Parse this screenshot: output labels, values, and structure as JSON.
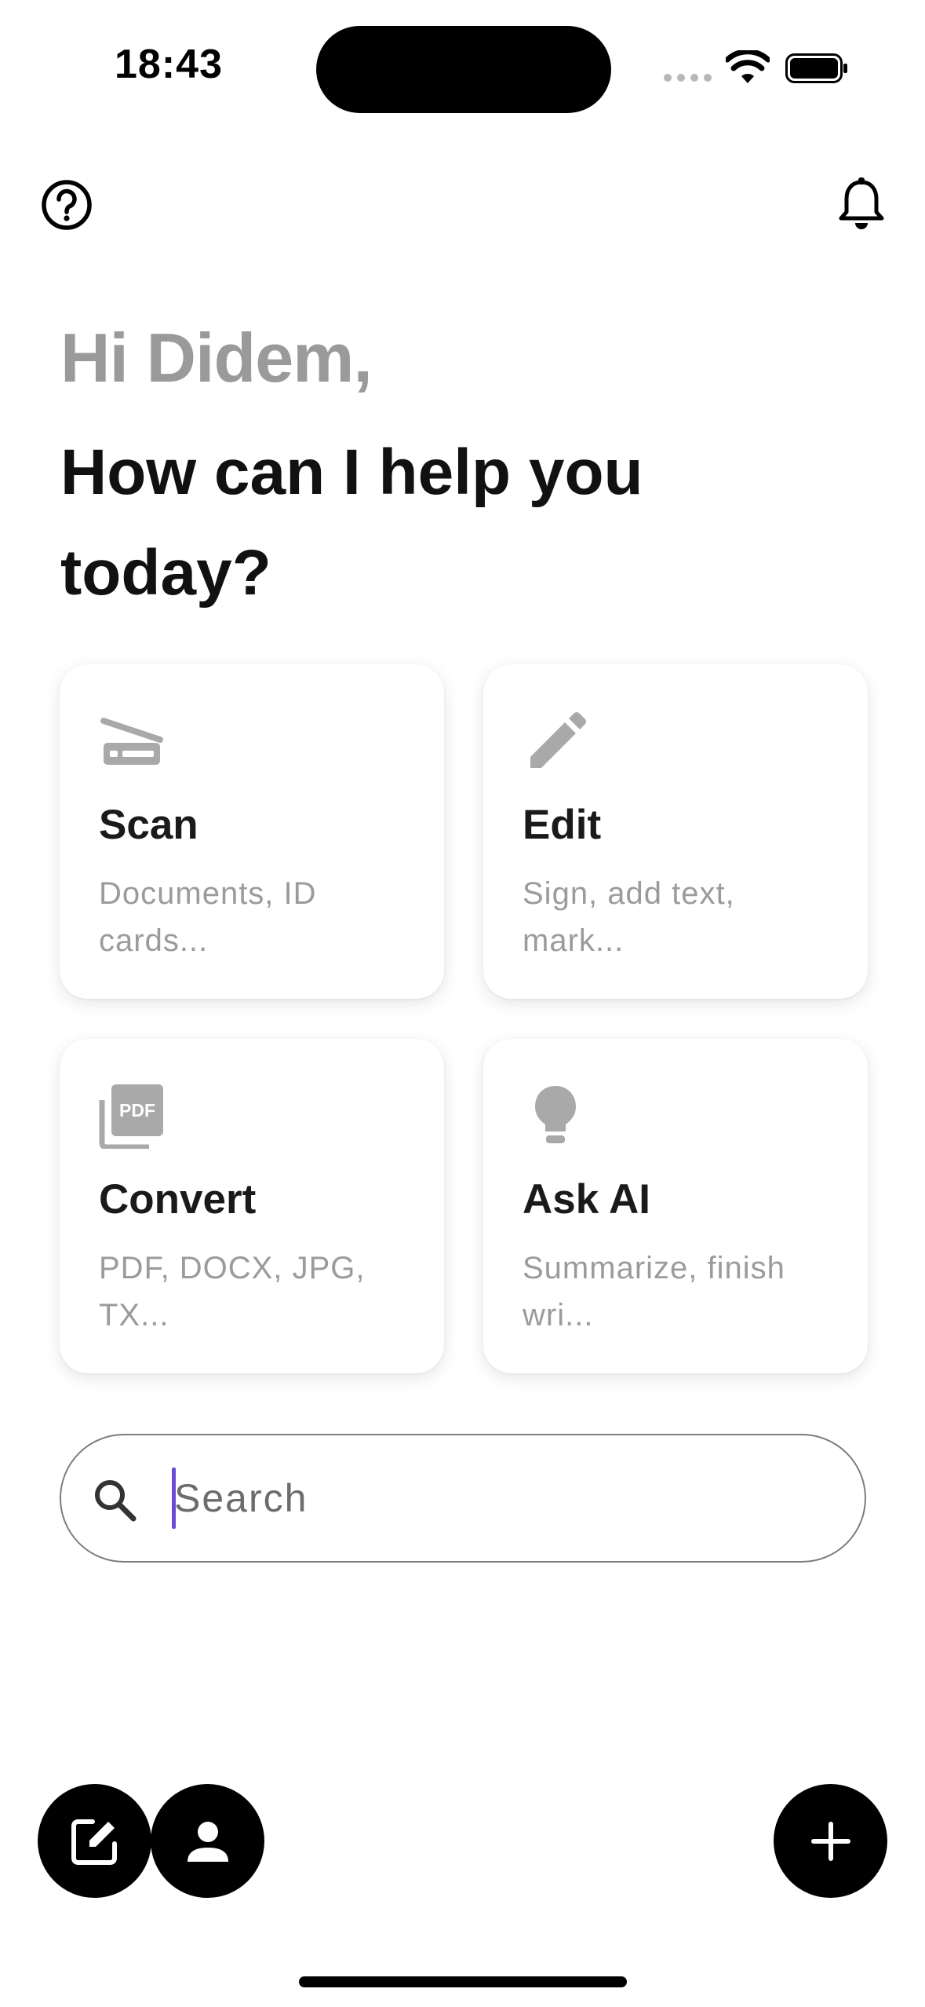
{
  "status_bar": {
    "time": "18:43"
  },
  "header": {
    "greeting": "Hi Didem,",
    "headline": "How can I help you today?"
  },
  "actions": [
    {
      "title": "Scan",
      "description": "Documents, ID cards...",
      "icon": "scanner-icon"
    },
    {
      "title": "Edit",
      "description": "Sign, add text, mark...",
      "icon": "pencil-icon"
    },
    {
      "title": "Convert",
      "description": "PDF, DOCX, JPG, TX...",
      "icon": "pdf-icon"
    },
    {
      "title": "Ask AI",
      "description": "Summarize, finish wri...",
      "icon": "lightbulb-icon"
    }
  ],
  "search": {
    "placeholder": "Search",
    "value": ""
  },
  "bottom_bar": {
    "left_buttons": [
      "edit-note-icon",
      "person-icon"
    ],
    "right_button": "plus-icon"
  },
  "colors": {
    "greeting": "#9a9a9a",
    "card_icon": "#a9a9a9",
    "cursor": "#6b4bd0",
    "fab": "#000000"
  }
}
